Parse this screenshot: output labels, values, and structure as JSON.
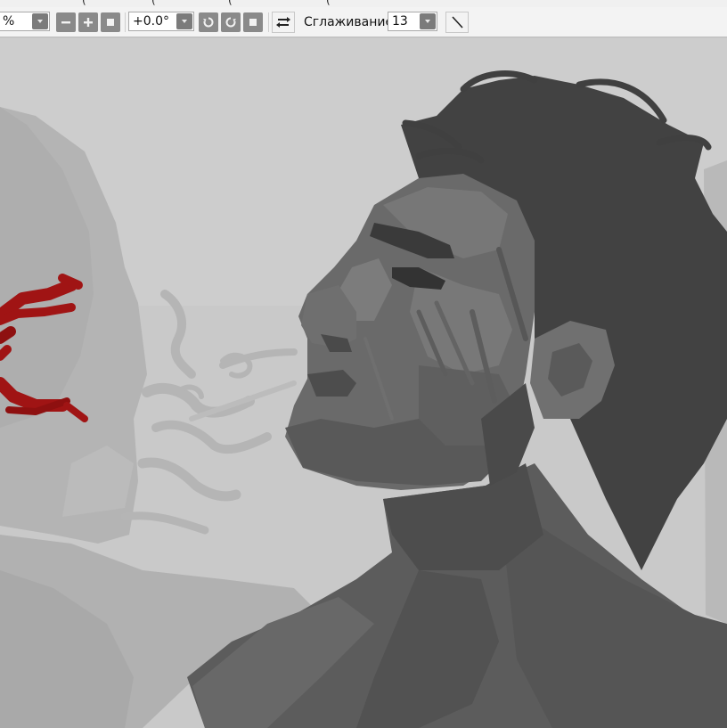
{
  "toolbar": {
    "zoom_value": "%",
    "angle_value": "+0.0°",
    "smoothing_label": "Сглаживание",
    "smoothing_value": "13"
  },
  "icons": {
    "zoom_out": "minus-icon",
    "zoom_in": "plus-icon",
    "zoom_reset": "square-icon",
    "rotate_ccw": "rotate-left-icon",
    "rotate_cw": "rotate-right-icon",
    "rotate_reset": "square-icon",
    "flip": "flip-horizontal-icon",
    "stabilizer": "diagonal-line-icon"
  },
  "colors": {
    "toolbar_bg": "#f3f3f3",
    "button_bg": "#8a8a8a",
    "canvas_bg": "#c7c7c7",
    "accent_red": "#a01414"
  }
}
